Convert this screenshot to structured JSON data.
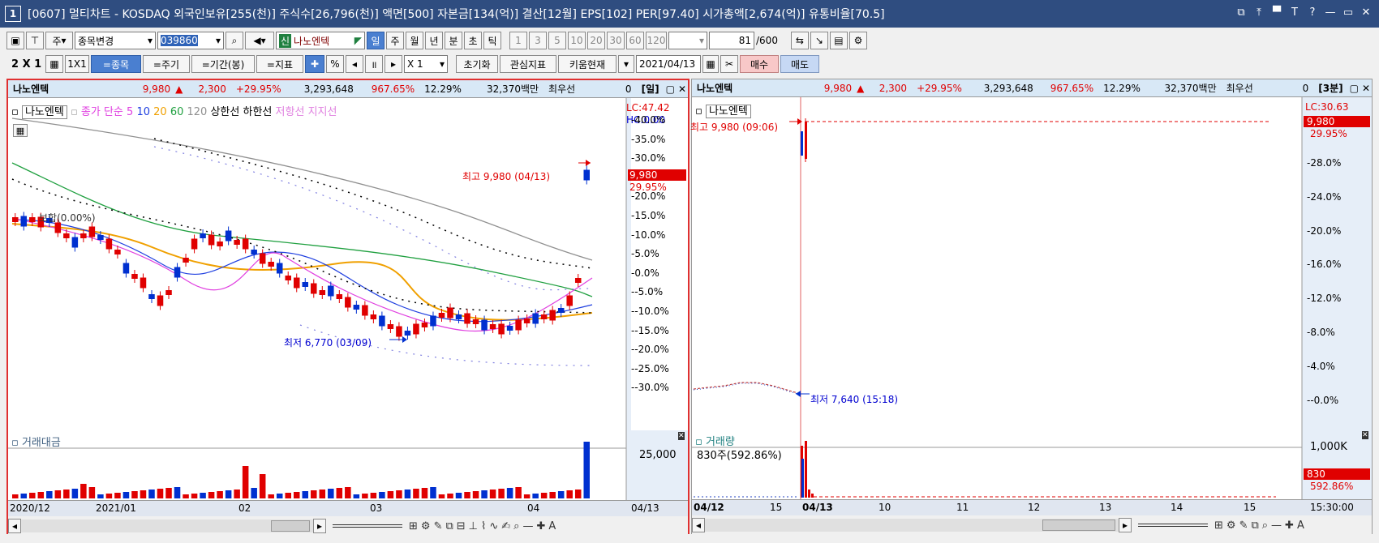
{
  "window": {
    "number": "1",
    "title": "[0607] 멀티차트 - KOSDAQ 외국인보유[255(천)] 주식수[26,796(천)] 액면[500] 자본금[134(억)] 결산[12월] EPS[102] PER[97.40] 시가총액[2,674(억)] 유통비율[70.5]",
    "controls": [
      "⧉",
      "⤒",
      "▀",
      "T",
      "?",
      "—",
      "▭",
      "✕"
    ]
  },
  "toolbar1": {
    "type_label": "주",
    "change_label": "종목변경",
    "code": "039860",
    "stock_badge": "신",
    "stock_name": "나노엔텍",
    "periods": [
      "일",
      "주",
      "월",
      "년",
      "분",
      "초",
      "틱"
    ],
    "intervals": [
      "1",
      "3",
      "5",
      "10",
      "20",
      "30",
      "60",
      "120"
    ],
    "count": "81",
    "count_max": "/600"
  },
  "toolbar2": {
    "layout": "2 X 1",
    "layout_1x1": "1X1",
    "tabs": [
      "=종목",
      "=주기",
      "=기간(봉)",
      "=지표"
    ],
    "percent": "%",
    "multiplier": "X 1",
    "reset": "초기화",
    "interest": "관심지표",
    "kiwoom": "키움현재",
    "date": "2021/04/13",
    "buy": "매수",
    "sell": "매도"
  },
  "left_panel": {
    "info": {
      "name": "나노엔텍",
      "price": "9,980",
      "change": "2,300",
      "rate": "+29.95%",
      "volume": "3,293,648",
      "vol_rate": "967.65%",
      "turnover": "12.29%",
      "amount": "32,370백만",
      "priority": "최우선",
      "priority_val": "0",
      "period": "[일]"
    },
    "legend": {
      "stock": "나노엔텍",
      "ma_label": "종가 단순",
      "ma": [
        "5",
        "10",
        "20",
        "60",
        "120"
      ],
      "upper": "상한선",
      "lower": "하한선",
      "resistance": "저항선",
      "support": "지지선"
    },
    "lc": "LC:47.42",
    "hc": "HC:0.00",
    "price_tag": "9,980",
    "price_pct": "29.95%",
    "flat_label": "보합(0.00%)",
    "high_label": "최고 9,980 (04/13)",
    "low_label": "최저 6,770 (03/09)",
    "scale": [
      "40.0%",
      "35.0%",
      "30.0%",
      "25.0%",
      "20.0%",
      "15.0%",
      "10.0%",
      "5.0%",
      "0.0%",
      "-5.0%",
      "-10.0%",
      "-15.0%",
      "-20.0%",
      "-25.0%",
      "-30.0%"
    ],
    "sub_title": "거래대금",
    "sub_scale": "25,000",
    "xaxis": [
      "2020/12",
      "2021/01",
      "02",
      "03",
      "04"
    ],
    "xaxis_right": "04/13"
  },
  "right_panel": {
    "info": {
      "name": "나노엔텍",
      "price": "9,980",
      "change": "2,300",
      "rate": "+29.95%",
      "volume": "3,293,648",
      "vol_rate": "967.65%",
      "turnover": "12.29%",
      "amount": "32,370백만",
      "priority": "최우선",
      "priority_val": "0",
      "period": "[3분]"
    },
    "legend": {
      "stock": "나노엔텍"
    },
    "lc": "LC:30.63",
    "price_tag": "9,980",
    "price_pct": "29.95%",
    "high_label": "최고 9,980 (09:06)",
    "low_label": "최저 7,640 (15:18)",
    "scale": [
      "28.0%",
      "24.0%",
      "20.0%",
      "16.0%",
      "12.0%",
      "8.0%",
      "4.0%",
      "-0.0%"
    ],
    "sub_title": "거래량",
    "sub_value": "830주(592.86%)",
    "sub_scale": "1,000K",
    "sub_tag": "830",
    "sub_pct": "592.86%",
    "xaxis": [
      "04/12",
      "15",
      "04/13",
      "10",
      "11",
      "12",
      "13",
      "14",
      "15"
    ],
    "xaxis_right": "15:30:00"
  },
  "colors": {
    "up": "#e00000",
    "down": "#0030d0",
    "ma5": "#e040e0",
    "ma10": "#2040e0",
    "ma20": "#f0a000",
    "ma60": "#20a040",
    "ma120": "#909090",
    "accent": "#2f4d80"
  }
}
